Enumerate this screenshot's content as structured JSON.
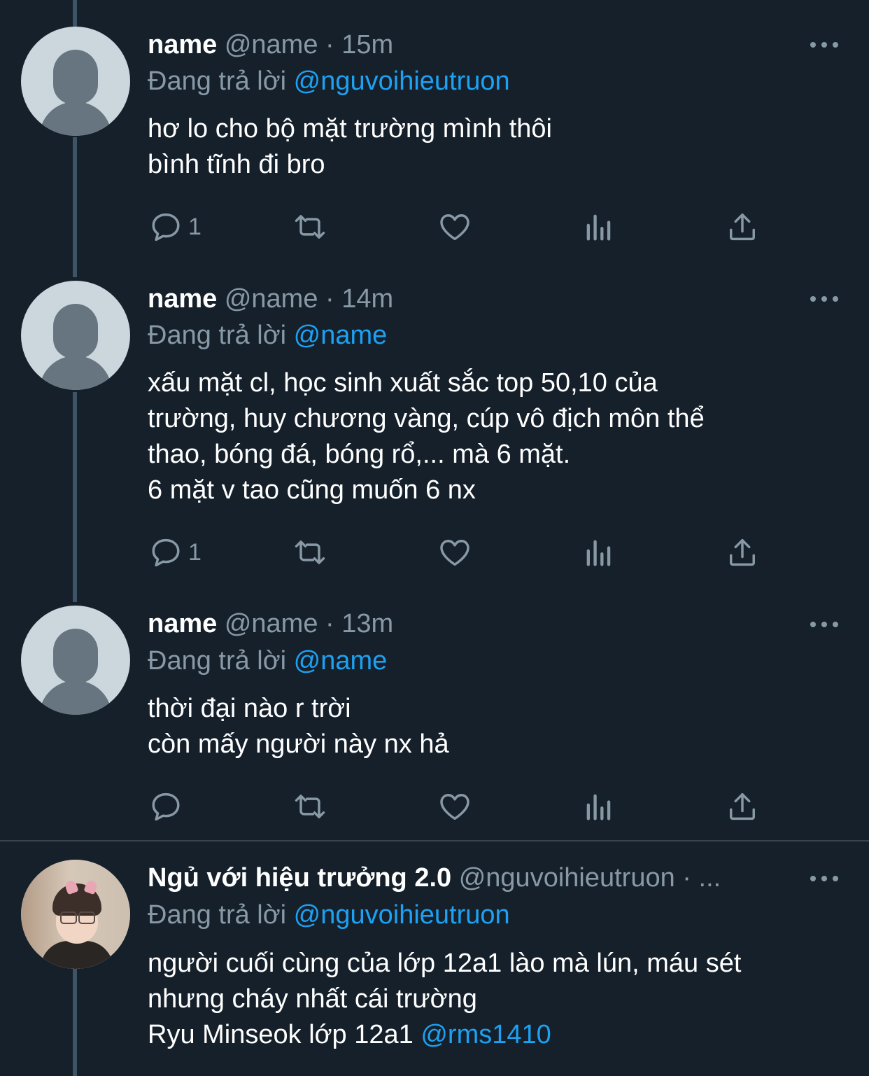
{
  "colors": {
    "background": "#15202b",
    "secondary_text": "#8899a6",
    "link": "#1da1f2",
    "thread_line": "#3d5466"
  },
  "tweets": [
    {
      "name": "name",
      "handle": "@name",
      "separator": "·",
      "time": "15m",
      "replying_prefix": "Đang trả lời",
      "replying_to": "@nguvoihieutruon",
      "lines": [
        "hơ lo cho bộ mặt trường mình thôi",
        "bình tĩnh đi bro"
      ],
      "reply_count": "1",
      "avatar": "default-profile-avatar"
    },
    {
      "name": "name",
      "handle": "@name",
      "separator": "·",
      "time": "14m",
      "replying_prefix": "Đang trả lời",
      "replying_to": "@name",
      "lines": [
        "xấu mặt cl, học sinh xuất sắc top 50,10 của",
        "trường, huy chương vàng, cúp vô địch môn thể",
        "thao, bóng đá, bóng rổ,... mà 6 mặt.",
        "6 mặt v tao cũng muốn 6 nx"
      ],
      "reply_count": "1",
      "avatar": "default-profile-avatar"
    },
    {
      "name": "name",
      "handle": "@name",
      "separator": "·",
      "time": "13m",
      "replying_prefix": "Đang trả lời",
      "replying_to": "@name",
      "lines": [
        "thời đại nào r trời",
        "còn mấy người này nx hả"
      ],
      "reply_count": "",
      "avatar": "default-profile-avatar"
    },
    {
      "name": "Ngủ với hiệu trưởng 2.0",
      "handle": "@nguvoihieutruon",
      "separator": "·",
      "time": "...",
      "replying_prefix": "Đang trả lời",
      "replying_to": "@nguvoihieutruon",
      "lines": [
        "người cuối cùng của lớp 12a1 lào mà lún, máu sét",
        "nhưng cháy nhất cái trường"
      ],
      "last_line_text": "Ryu Minseok lớp 12a1",
      "last_line_mention": "@rms1410",
      "avatar": "profile-photo-avatar"
    }
  ],
  "icons": [
    "reply-icon",
    "retweet-icon",
    "like-icon",
    "analytics-icon",
    "share-icon",
    "more-icon"
  ]
}
